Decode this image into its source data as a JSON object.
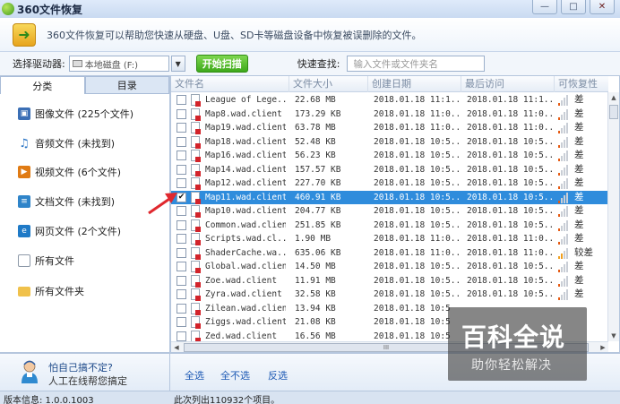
{
  "window": {
    "title": "360文件恢复",
    "minimize_label": "—",
    "maximize_label": "□",
    "close_label": "✕"
  },
  "banner": {
    "text": "360文件恢复可以帮助您快速从硬盘、U盘、SD卡等磁盘设备中恢复被误删除的文件。"
  },
  "toolbar": {
    "drive_label": "选择驱动器:",
    "drive_value": "本地磁盘 (F:)",
    "rescan_label": "开始扫描",
    "quick_search_label": "快速查找:",
    "quick_search_placeholder": "输入文件或文件夹名"
  },
  "sidebar": {
    "tabs": [
      {
        "label": "分类",
        "active": true
      },
      {
        "label": "目录",
        "active": false
      }
    ],
    "items": [
      {
        "label": "图像文件 (225个文件)",
        "icon": "image-icon",
        "color": "#3b6fb5"
      },
      {
        "label": "音频文件 (未找到)",
        "icon": "music-icon",
        "color": "#2a74c5"
      },
      {
        "label": "视频文件 (6个文件)",
        "icon": "video-icon",
        "color": "#e07b14"
      },
      {
        "label": "文档文件 (未找到)",
        "icon": "document-icon",
        "color": "#2f84c9"
      },
      {
        "label": "网页文件 (2个文件)",
        "icon": "webpage-icon",
        "color": "#1f7ac7"
      },
      {
        "label": "所有文件",
        "icon": "file-icon",
        "color": "#ffffff"
      },
      {
        "label": "所有文件夹",
        "icon": "folder-icon",
        "color": "#f0c14b"
      }
    ]
  },
  "help": {
    "line1": "怕自己搞不定?",
    "line2": "人工在线帮您搞定"
  },
  "table": {
    "columns": [
      "文件名",
      "文件大小",
      "创建日期",
      "最后访问",
      "可恢复性"
    ],
    "rows": [
      {
        "name": "League of Lege...",
        "size": "22.68 MB",
        "created": "2018.01.18 11:1...",
        "accessed": "2018.01.18 11:1...",
        "rec": "差",
        "checked": false,
        "selected": false
      },
      {
        "name": "Map8.wad.client",
        "size": "173.29 KB",
        "created": "2018.01.18 11:0...",
        "accessed": "2018.01.18 11:0...",
        "rec": "差",
        "checked": false,
        "selected": false
      },
      {
        "name": "Map19.wad.client",
        "size": "63.78 MB",
        "created": "2018.01.18 11:0...",
        "accessed": "2018.01.18 11:0...",
        "rec": "差",
        "checked": false,
        "selected": false
      },
      {
        "name": "Map18.wad.client",
        "size": "52.48 KB",
        "created": "2018.01.18 10:5...",
        "accessed": "2018.01.18 10:5...",
        "rec": "差",
        "checked": false,
        "selected": false
      },
      {
        "name": "Map16.wad.client",
        "size": "56.23 KB",
        "created": "2018.01.18 10:5...",
        "accessed": "2018.01.18 10:5...",
        "rec": "差",
        "checked": false,
        "selected": false
      },
      {
        "name": "Map14.wad.client",
        "size": "157.57 KB",
        "created": "2018.01.18 10:5...",
        "accessed": "2018.01.18 10:5...",
        "rec": "差",
        "checked": false,
        "selected": false
      },
      {
        "name": "Map12.wad.client",
        "size": "227.70 KB",
        "created": "2018.01.18 10:5...",
        "accessed": "2018.01.18 10:5...",
        "rec": "差",
        "checked": false,
        "selected": false
      },
      {
        "name": "Map11.wad.client",
        "size": "460.91 KB",
        "created": "2018.01.18 10:5...",
        "accessed": "2018.01.18 10:5...",
        "rec": "差",
        "checked": true,
        "selected": true
      },
      {
        "name": "Map10.wad.client",
        "size": "204.77 KB",
        "created": "2018.01.18 10:5...",
        "accessed": "2018.01.18 10:5...",
        "rec": "差",
        "checked": false,
        "selected": false
      },
      {
        "name": "Common.wad.client",
        "size": "251.85 KB",
        "created": "2018.01.18 10:5...",
        "accessed": "2018.01.18 10:5...",
        "rec": "差",
        "checked": false,
        "selected": false
      },
      {
        "name": "Scripts.wad.cl...",
        "size": "1.90 MB",
        "created": "2018.01.18 11:0...",
        "accessed": "2018.01.18 11:0...",
        "rec": "差",
        "checked": false,
        "selected": false
      },
      {
        "name": "ShaderCache.wa...",
        "size": "635.06 KB",
        "created": "2018.01.18 11:0...",
        "accessed": "2018.01.18 11:0...",
        "rec": "较差",
        "checked": false,
        "selected": false
      },
      {
        "name": "Global.wad.client",
        "size": "14.50 MB",
        "created": "2018.01.18 10:5...",
        "accessed": "2018.01.18 10:5...",
        "rec": "差",
        "checked": false,
        "selected": false
      },
      {
        "name": "Zoe.wad.client",
        "size": "11.91 MB",
        "created": "2018.01.18 10:5...",
        "accessed": "2018.01.18 10:5...",
        "rec": "差",
        "checked": false,
        "selected": false
      },
      {
        "name": "Zyra.wad.client",
        "size": "32.58 KB",
        "created": "2018.01.18 10:5...",
        "accessed": "2018.01.18 10:5...",
        "rec": "差",
        "checked": false,
        "selected": false
      },
      {
        "name": "Zilean.wad.client",
        "size": "13.94 KB",
        "created": "2018.01.18 10:5",
        "accessed": "",
        "rec": "",
        "checked": false,
        "selected": false
      },
      {
        "name": "Ziggs.wad.client",
        "size": "21.08 KB",
        "created": "2018.01.18 10:5",
        "accessed": "",
        "rec": "",
        "checked": false,
        "selected": false
      },
      {
        "name": "Zed.wad.client",
        "size": "16.56 MB",
        "created": "2018.01.18 10:5",
        "accessed": "",
        "rec": "",
        "checked": false,
        "selected": false
      }
    ],
    "hscroll_grip": "III"
  },
  "select_bar": {
    "select_all": "全选",
    "select_none": "全不选",
    "invert": "反选"
  },
  "status": {
    "version": "版本信息: 1.0.0.1003",
    "count": "此次列出110932个项目。"
  },
  "watermark": {
    "big": "百科全说",
    "small": "助你轻松解决"
  },
  "colors": {
    "accent": "#2f8cdc",
    "rescan": "#3ea91b",
    "bad_bar": "#e55a12",
    "fair_bar": "#f0a020"
  }
}
